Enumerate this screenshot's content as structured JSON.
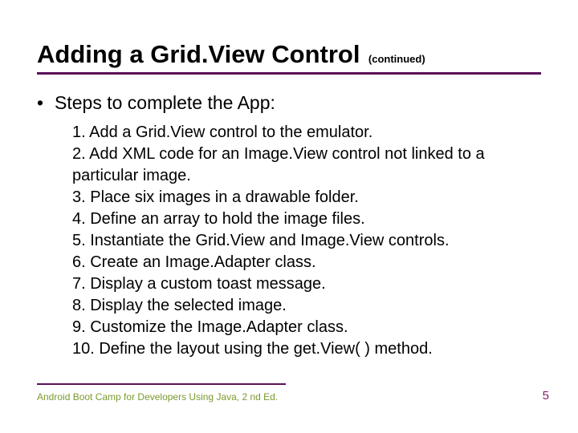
{
  "header": {
    "title": "Adding a Grid.View Control",
    "subtitle": "(continued)"
  },
  "bullet": {
    "text": "Steps to complete the App:"
  },
  "steps": [
    "1. Add a Grid.View control to the emulator.",
    "2. Add XML code for an Image.View control not linked to a particular image.",
    "3. Place six images in a drawable folder.",
    "4. Define an array to hold the image files.",
    "5. Instantiate the Grid.View and Image.View controls.",
    "6. Create an Image.Adapter class.",
    "7. Display a custom toast message.",
    "8. Display the selected image.",
    "9. Customize the Image.Adapter class.",
    "10. Define the layout using the get.View( ) method."
  ],
  "footer": {
    "text": "Android Boot Camp for Developers Using Java, 2 nd Ed.",
    "page": "5"
  }
}
